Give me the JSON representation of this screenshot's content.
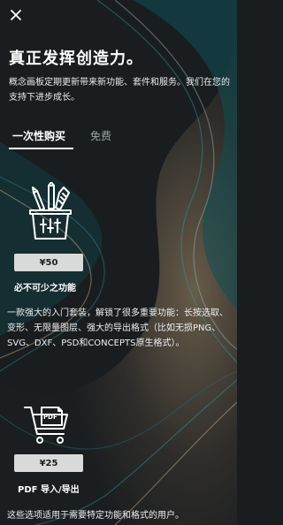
{
  "header": {
    "title": "真正发挥创造力。",
    "description": "概念画板定期更新带来新功能、套件和服务。我们在您的支持下进步成长。"
  },
  "tabs": [
    {
      "label": "一次性购买",
      "selected": true
    },
    {
      "label": "免费",
      "selected": false
    }
  ],
  "packages": [
    {
      "price": "¥50",
      "name": "必不可少之功能",
      "description": "一款强大的入门套装，解锁了很多重要功能：长按选取、变形、无限量图层、强大的导出格式（比如无损PNG、SVG、DXF、PSD和CONCEPTS原生格式）。",
      "icon": "tools-cup-icon"
    },
    {
      "price": "¥25",
      "name": "PDF 导入/导出",
      "description": "",
      "icon": "pdf-cart-icon",
      "icon_text": "PDF"
    }
  ],
  "footer": {
    "text": "这些选项适用于需要特定功能和格式的用户。"
  },
  "colors": {
    "background": "#1a1d1f",
    "teal": "#0f4f56",
    "tan": "#a88f6c",
    "price_button": "#d8dbd9"
  }
}
